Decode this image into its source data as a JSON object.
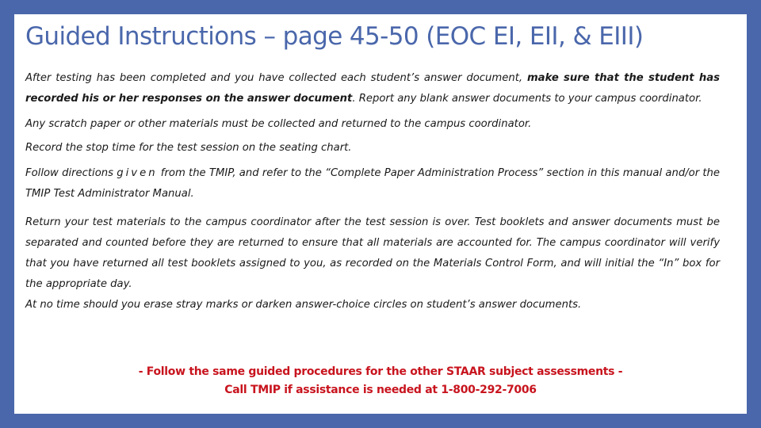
{
  "colors": {
    "background": "#4a67ab",
    "panel": "#ffffff",
    "title": "#4a67ab",
    "body_text": "#1a1a1a",
    "footer_text": "#c8141e"
  },
  "title": "Guided Instructions – page 45-50 (EOC EI, EII, & EIII)",
  "paragraphs": {
    "p1": {
      "text_before": "After testing has been completed and you have collected each student’s answer document, ",
      "bold": "make sure that the student has recorded his or her responses on the answer document",
      "text_after": ". Report any blank answer documents to your campus coordinator."
    },
    "p2": "Any scratch paper or other materials must be collected and returned to the campus coordinator.",
    "p3": "Record the stop time for the test session on the seating chart.",
    "p4": {
      "text_before": "Follow directions ",
      "spaced_word": "given",
      "text_after": " from the TMIP, and refer to the “Complete Paper Administration Process” section in this manual and/or the TMIP Test Administrator Manual."
    },
    "p5": "Return your test materials to the campus coordinator after the test session is over. Test booklets and answer documents must be separated and counted before they are returned to ensure that all materials are accounted for. The campus coordinator will verify that you have returned all test booklets assigned to you, as recorded on the Materials Control Form, and will initial the “In” box for the appropriate day.",
    "p6": "At no time should you erase stray marks or darken answer-choice circles on student’s answer documents."
  },
  "footer": {
    "line1": "- Follow the same guided procedures for the other STAAR subject assessments -",
    "line2": "Call TMIP if assistance is needed at 1-800-292-7006"
  }
}
